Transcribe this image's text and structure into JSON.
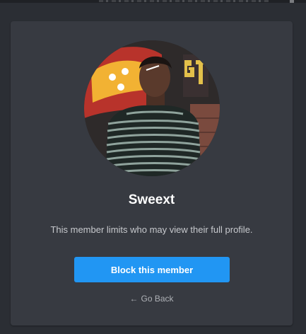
{
  "profile": {
    "name": "Sweext",
    "notice": "This member limits who may view their full profile.",
    "avatar_alt": "member-avatar-photo"
  },
  "actions": {
    "block_label": "Block this member",
    "back_arrow": "←",
    "back_label": "Go Back"
  },
  "colors": {
    "background": "#2b2e34",
    "card": "#373a41",
    "accent": "#2196f3",
    "text_primary": "#ffffff",
    "text_secondary": "#c7c9cd"
  }
}
